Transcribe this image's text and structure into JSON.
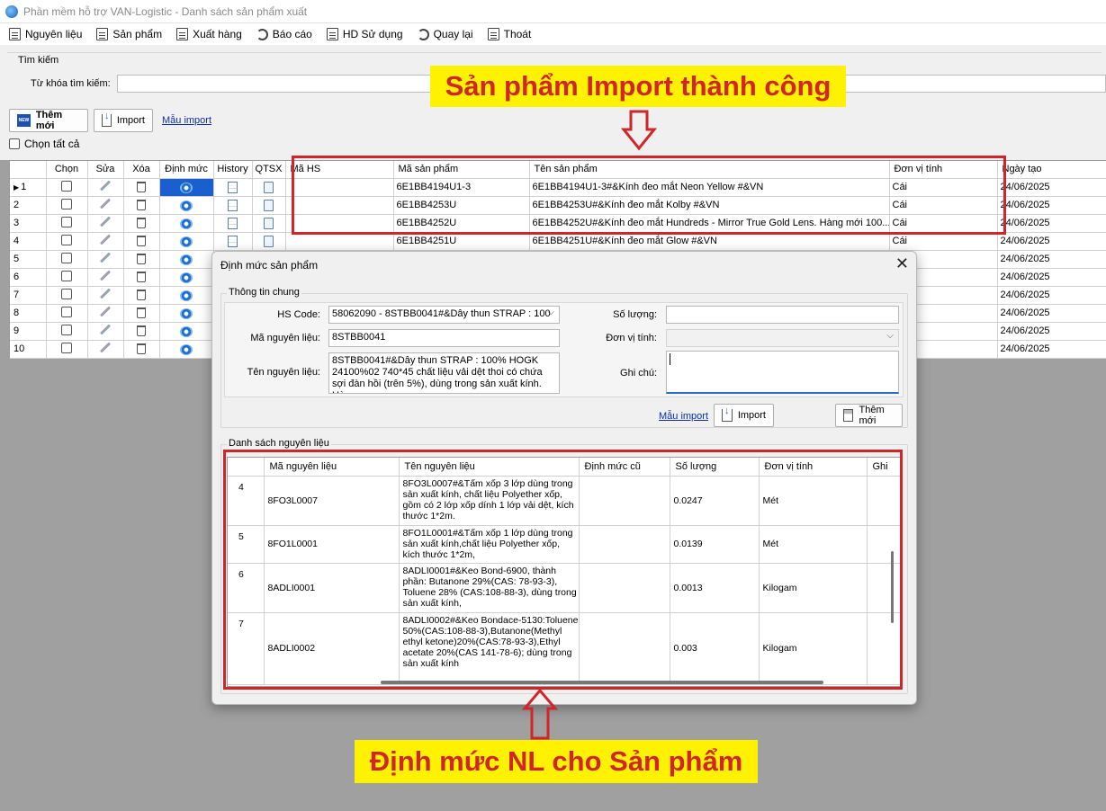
{
  "window": {
    "title": "Phần mềm hỗ trợ VAN-Logistic - Danh sách sản phẩm xuất"
  },
  "menu": [
    {
      "label": "Nguyên liệu",
      "icon": "document-icon"
    },
    {
      "label": "Sản phẩm",
      "icon": "document-icon"
    },
    {
      "label": "Xuất hàng",
      "icon": "document-icon"
    },
    {
      "label": "Báo cáo",
      "icon": "search-icon"
    },
    {
      "label": "HD Sử dụng",
      "icon": "document-icon"
    },
    {
      "label": "Quay lại",
      "icon": "refresh-icon"
    },
    {
      "label": "Thoát",
      "icon": "exit-icon"
    }
  ],
  "search": {
    "group_label": "Tìm kiếm",
    "keyword_label": "Từ khóa tìm kiếm:",
    "keyword_value": ""
  },
  "toolbar": {
    "new_label": "Thêm mới",
    "new_icon_text": "NEW",
    "import_label": "Import",
    "template_link": "Mẫu import",
    "select_all": "Chọn tất cả"
  },
  "grid": {
    "headers": [
      "Chọn",
      "Sửa",
      "Xóa",
      "Định mức",
      "History",
      "QTSX",
      "Mã HS",
      "Mã sản phẩm",
      "Tên sản phẩm",
      "Đơn vị tính",
      "Ngày tạo"
    ],
    "rows": [
      {
        "no": "1",
        "hs": "",
        "code": "6E1BB4194U1-3",
        "name": "6E1BB4194U1-3#&Kính đeo mắt   Neon Yellow #&VN",
        "unit": "Cái",
        "date": "24/06/2025"
      },
      {
        "no": "2",
        "hs": "",
        "code": "6E1BB4253U",
        "name": "6E1BB4253U#&Kính đeo mắt   Kolby #&VN",
        "unit": "Cái",
        "date": "24/06/2025"
      },
      {
        "no": "3",
        "hs": "",
        "code": "6E1BB4252U",
        "name": "6E1BB4252U#&Kính đeo mắt   Hundreds - Mirror True Gold Lens. Hàng mới 100...",
        "unit": "Cái",
        "date": "24/06/2025"
      },
      {
        "no": "4",
        "hs": "",
        "code": "6E1BB4251U",
        "name": "6E1BB4251U#&Kính đeo mắt   Glow #&VN",
        "unit": "Cái",
        "date": "24/06/2025"
      },
      {
        "no": "5",
        "hs": "",
        "code": "",
        "name": "",
        "unit": "",
        "date": "24/06/2025"
      },
      {
        "no": "6",
        "hs": "",
        "code": "",
        "name": "",
        "unit": "",
        "date": "24/06/2025"
      },
      {
        "no": "7",
        "hs": "",
        "code": "",
        "name": "",
        "unit": "",
        "date": "24/06/2025"
      },
      {
        "no": "8",
        "hs": "",
        "code": "",
        "name": "",
        "unit": "",
        "date": "24/06/2025"
      },
      {
        "no": "9",
        "hs": "",
        "code": "",
        "name": "",
        "unit": "",
        "date": "24/06/2025"
      },
      {
        "no": "10",
        "hs": "",
        "code": "",
        "name": "",
        "unit": "",
        "date": "24/06/2025"
      }
    ]
  },
  "annotations": {
    "top": "Sản phẩm Import thành công",
    "bottom": "Định mức NL cho Sản phẩm",
    "color": "#d0262a",
    "banner_bg": "#fff200"
  },
  "dialog": {
    "title": "Định mức sản phẩm",
    "general_group": "Thông tin chung",
    "hs_code_label": "HS Code:",
    "hs_code_value": "58062090 - 8STBB0041#&Dây thun STRAP : 100",
    "material_code_label": "Mã nguyên liệu:",
    "material_code_value": "8STBB0041",
    "material_name_label": "Tên nguyên liệu:",
    "material_name_value": "8STBB0041#&Dây thun STRAP : 100% HOGK 24100%02 740*45 chất liệu vải dệt thoi có chứa sợi đàn hồi (trên 5%), dùng trong sản xuất kính. Hàng",
    "quantity_label": "Số lượng:",
    "quantity_value": "",
    "unit_label": "Đơn vị tính:",
    "unit_value": "",
    "note_label": "Ghi chú:",
    "note_value": "",
    "template_link": "Mẫu import",
    "import_label": "Import",
    "new_label": "Thêm mới",
    "list_group": "Danh sách nguyên liệu",
    "list_headers": [
      "",
      "Mã nguyên liệu",
      "Tên nguyên liệu",
      "Định mức cũ",
      "Số lượng",
      "Đơn vị tính",
      "Ghi"
    ],
    "list_rows": [
      {
        "no": "4",
        "code": "8FO3L0007",
        "name": "8FO3L0007#&Tấm xốp 3 lớp dùng trong sản xuất kính, chất liệu Polyether xốp, gồm có 2 lớp xốp dính 1 lớp vải dệt, kích thước 1*2m.",
        "old": "",
        "qty": "0.0247",
        "unit": "Mét"
      },
      {
        "no": "5",
        "code": "8FO1L0001",
        "name": "8FO1L0001#&Tấm xốp 1 lớp dùng trong sản xuất kính,chất liệu Polyether xốp, kích thước 1*2m,",
        "old": "",
        "qty": "0.0139",
        "unit": "Mét"
      },
      {
        "no": "6",
        "code": "8ADLI0001",
        "name": "8ADLI0001#&Keo Bond-6900, thành phần: Butanone 29%(CAS: 78-93-3), Toluene 28% (CAS:108-88-3), dùng trong sản xuất kính,",
        "old": "",
        "qty": "0.0013",
        "unit": "Kilogam"
      },
      {
        "no": "7",
        "code": "8ADLI0002",
        "name": "8ADLI0002#&Keo Bondace-5130:Toluene 50%(CAS:108-88-3),Butanone(Methyl ethyl ketone)20%(CAS:78-93-3),Ethyl acetate 20%(CAS 141-78-6); dùng trong sản xuất kính",
        "old": "",
        "qty": "0.003",
        "unit": "Kilogam"
      }
    ]
  }
}
